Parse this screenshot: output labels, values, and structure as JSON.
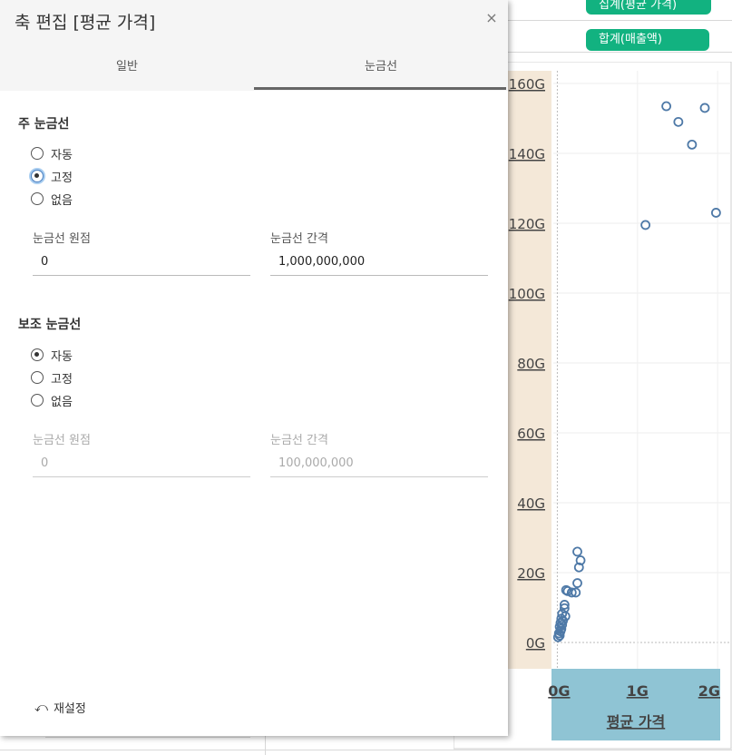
{
  "background": {
    "pills": [
      "집계(평균 가격)",
      "합계(매출액)"
    ]
  },
  "chart_data": {
    "type": "scatter",
    "xlabel": "평균 가격",
    "ylabel": "",
    "x_ticks": [
      "0G",
      "1G",
      "2G"
    ],
    "y_ticks": [
      "0G",
      "20G",
      "40G",
      "60G",
      "80G",
      "100G",
      "120G",
      "140G",
      "160G"
    ],
    "xlim": [
      -0.05,
      2.1
    ],
    "ylim": [
      0,
      160
    ],
    "point_color": "#4e79a7",
    "points": [
      [
        1.36,
        153.5
      ],
      [
        1.51,
        149
      ],
      [
        1.84,
        153
      ],
      [
        1.68,
        142.5
      ],
      [
        1.1,
        119.5
      ],
      [
        1.98,
        123
      ],
      [
        0.25,
        26
      ],
      [
        0.29,
        23.5
      ],
      [
        0.27,
        21.5
      ],
      [
        0.25,
        17
      ],
      [
        0.11,
        15
      ],
      [
        0.13,
        14.7
      ],
      [
        0.23,
        14.3
      ],
      [
        0.18,
        14.3
      ],
      [
        0.09,
        10.8
      ],
      [
        0.09,
        9.8
      ],
      [
        0.06,
        8.2
      ],
      [
        0.1,
        7.5
      ],
      [
        0.05,
        6.8
      ],
      [
        0.07,
        6.2
      ],
      [
        0.04,
        5.6
      ],
      [
        0.06,
        5.1
      ],
      [
        0.03,
        4.5
      ],
      [
        0.05,
        3.9
      ],
      [
        0.04,
        3.2
      ],
      [
        0.02,
        2.6
      ],
      [
        0.03,
        2.0
      ],
      [
        0.01,
        1.5
      ]
    ]
  },
  "dialog": {
    "title": "축 편집 [평균 가격]",
    "close_label": "×",
    "tabs": [
      "일반",
      "눈금선"
    ],
    "major": {
      "title": "주 눈금선",
      "options": [
        "자동",
        "고정",
        "없음"
      ],
      "selected": "고정",
      "origin_label": "눈금선 원점",
      "origin_value": "0",
      "interval_label": "눈금선 간격",
      "interval_value": "1,000,000,000"
    },
    "minor": {
      "title": "보조 눈금선",
      "options": [
        "자동",
        "고정",
        "없음"
      ],
      "selected": "자동",
      "origin_label": "눈금선 원점",
      "origin_value": "0",
      "interval_label": "눈금선 간격",
      "interval_value": "100,000,000"
    },
    "reset_label": "재설정",
    "reset_icon": "undo-icon"
  }
}
